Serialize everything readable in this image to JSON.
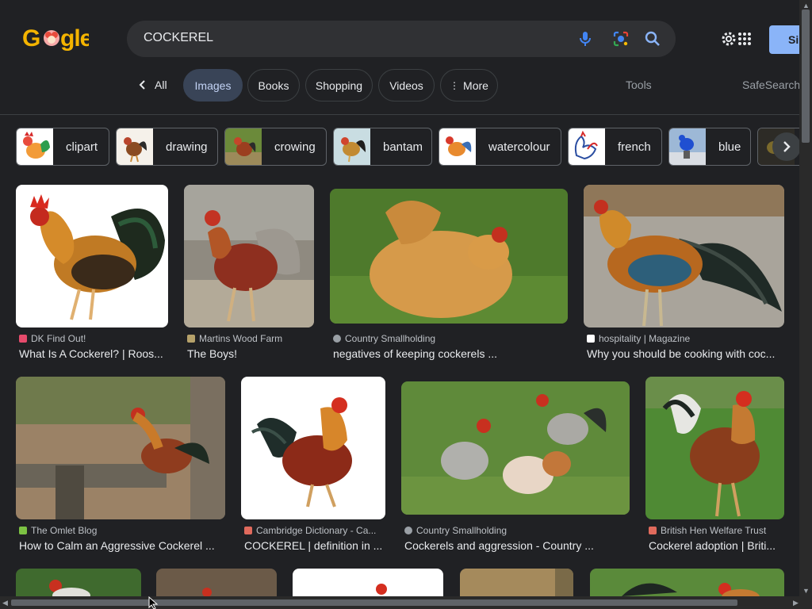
{
  "search": {
    "query": "COCKEREL"
  },
  "header": {
    "signin_label": "Si"
  },
  "tabs": {
    "all": "All",
    "images": "Images",
    "books": "Books",
    "shopping": "Shopping",
    "videos": "Videos",
    "more": "More",
    "tools": "Tools",
    "safesearch": "SafeSearch"
  },
  "chips": [
    {
      "label": "clipart"
    },
    {
      "label": "drawing"
    },
    {
      "label": "crowing"
    },
    {
      "label": "bantam"
    },
    {
      "label": "watercolour"
    },
    {
      "label": "french"
    },
    {
      "label": "blue"
    }
  ],
  "results": [
    {
      "source": "DK Find Out!",
      "title": "What Is A Cockerel? | Roos..."
    },
    {
      "source": "Martins Wood Farm",
      "title": "The Boys!"
    },
    {
      "source": "Country Smallholding",
      "title": "negatives of keeping cockerels ..."
    },
    {
      "source": "hospitality | Magazine",
      "title": "Why you should be cooking with coc..."
    },
    {
      "source": "The Omlet Blog",
      "title": "How to Calm an Aggressive Cockerel ..."
    },
    {
      "source": "Cambridge Dictionary - Ca...",
      "title": "COCKEREL | definition in ..."
    },
    {
      "source": "Country Smallholding",
      "title": "Cockerels and aggression - Country ..."
    },
    {
      "source": "British Hen Welfare Trust",
      "title": "Cockerel adoption | Briti..."
    }
  ],
  "colors": {
    "background": "#202124",
    "accent": "#8ab4f8",
    "active_tab": "#394457"
  }
}
